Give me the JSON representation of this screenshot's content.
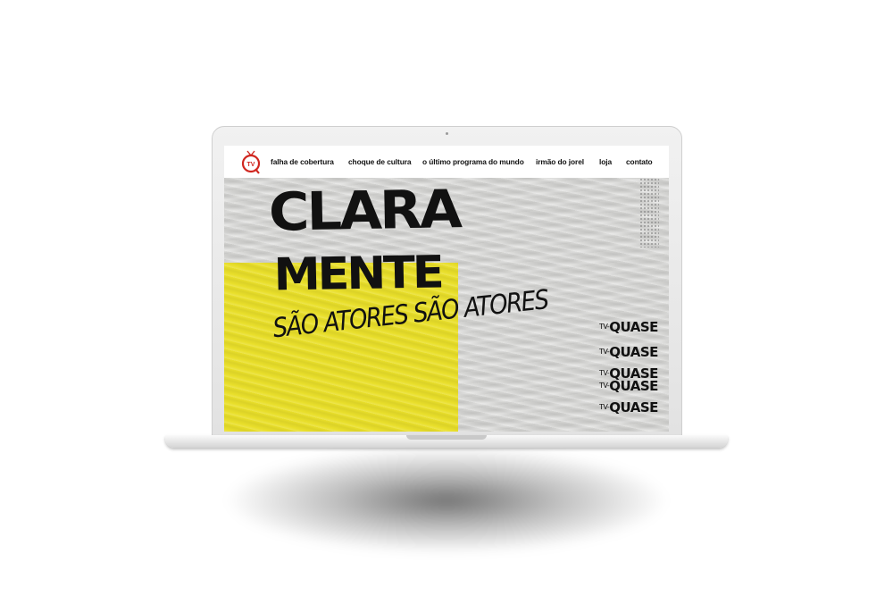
{
  "nav": {
    "logo_text": "TV",
    "items": [
      {
        "label": "falha de cobertura"
      },
      {
        "label": "choque de cultura"
      },
      {
        "label": "o último programa do mundo"
      },
      {
        "label": "irmão do jorel"
      },
      {
        "label": "loja"
      },
      {
        "label": "contato"
      }
    ]
  },
  "hero": {
    "title_line1": "CLARA",
    "title_line2": "MENTE",
    "subtitle": "SÃO ATORES SÃO ATORES",
    "tv_lines": [
      {
        "prefix": "TV-",
        "text": "QUASE"
      },
      {
        "prefix": "TV-",
        "text": "QUASE"
      },
      {
        "prefix": "TV-",
        "text": "QUASE"
      },
      {
        "prefix": "TV-",
        "text": "QUASE"
      },
      {
        "prefix": "TV-",
        "text": "QUASE"
      }
    ],
    "colors": {
      "accent_yellow": "#e9df2a",
      "paper_gray": "#d7d7d5",
      "ink": "#111111",
      "logo_red": "#d0261f"
    }
  }
}
